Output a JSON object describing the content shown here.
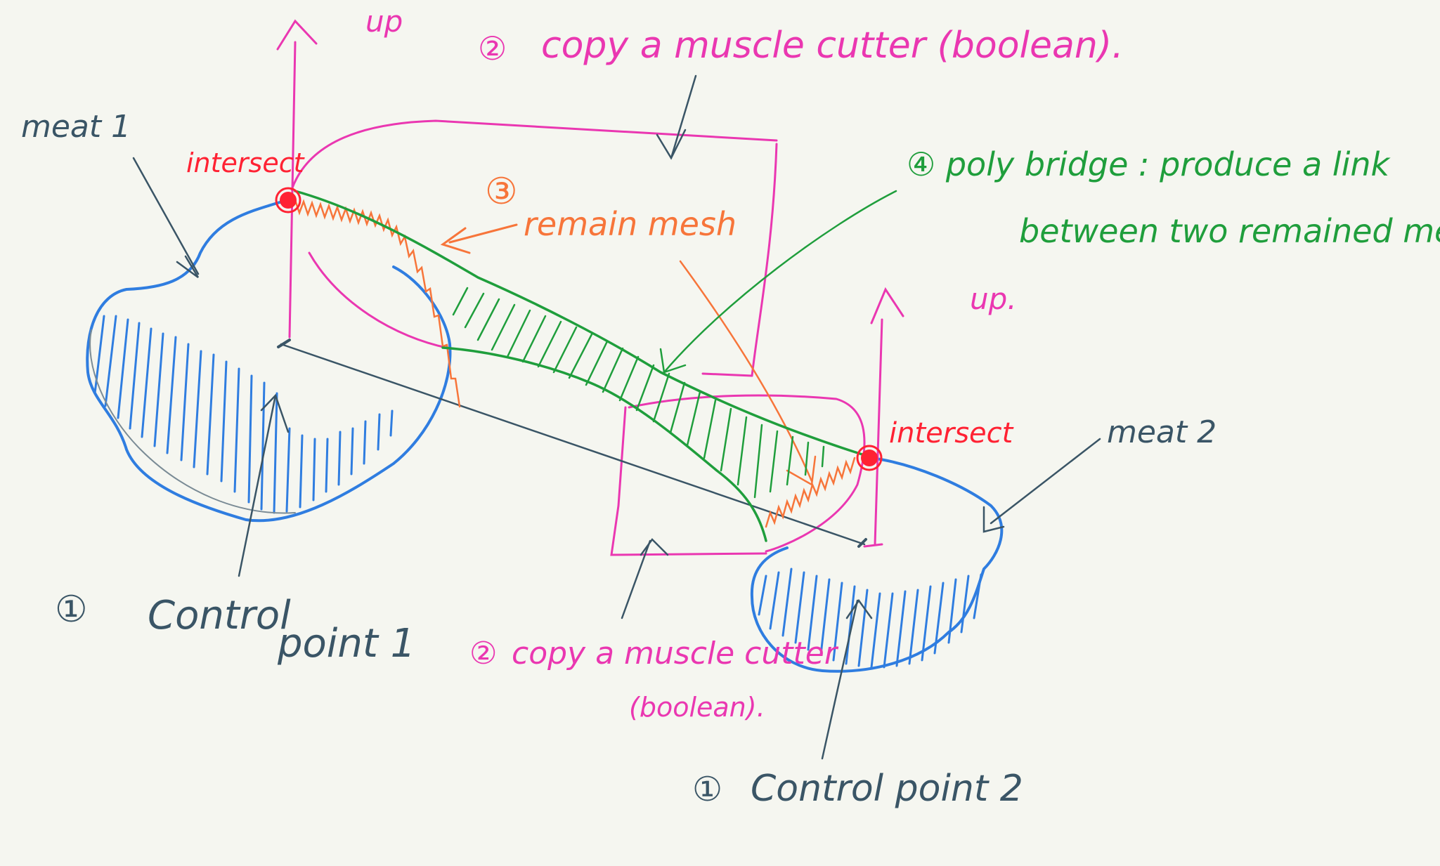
{
  "colors": {
    "background": "#f5f6f0",
    "meat_outline": "#2f7de0",
    "meat_hatch": "#2f7de0",
    "cutter": "#ea37b1",
    "remain_mesh": "#f7753a",
    "bridge": "#1f9e3c",
    "intersect": "#ff2233",
    "annotation": "#3a5566"
  },
  "labels": {
    "meat1": "meat 1",
    "meat2": "meat 2",
    "intersect_left": "intersect",
    "intersect_right": "intersect",
    "up_left": "up",
    "up_right": "up.",
    "step2_top_num": "②",
    "step2_top_text": "copy a muscle cutter (boolean).",
    "step3_num": "③",
    "step3_text": "remain mesh",
    "step4_line1": "④ poly bridge : produce a link",
    "step4_line2": "between two remained mesh",
    "step2_bottom_num": "②",
    "step2_bottom_line1": "copy a muscle cutter",
    "step2_bottom_line2": "(boolean).",
    "cp1_num": "①",
    "cp1_text_1": "Control",
    "cp1_text_2": "point 1",
    "cp2_num": "①",
    "cp2_text": "Control point 2"
  }
}
